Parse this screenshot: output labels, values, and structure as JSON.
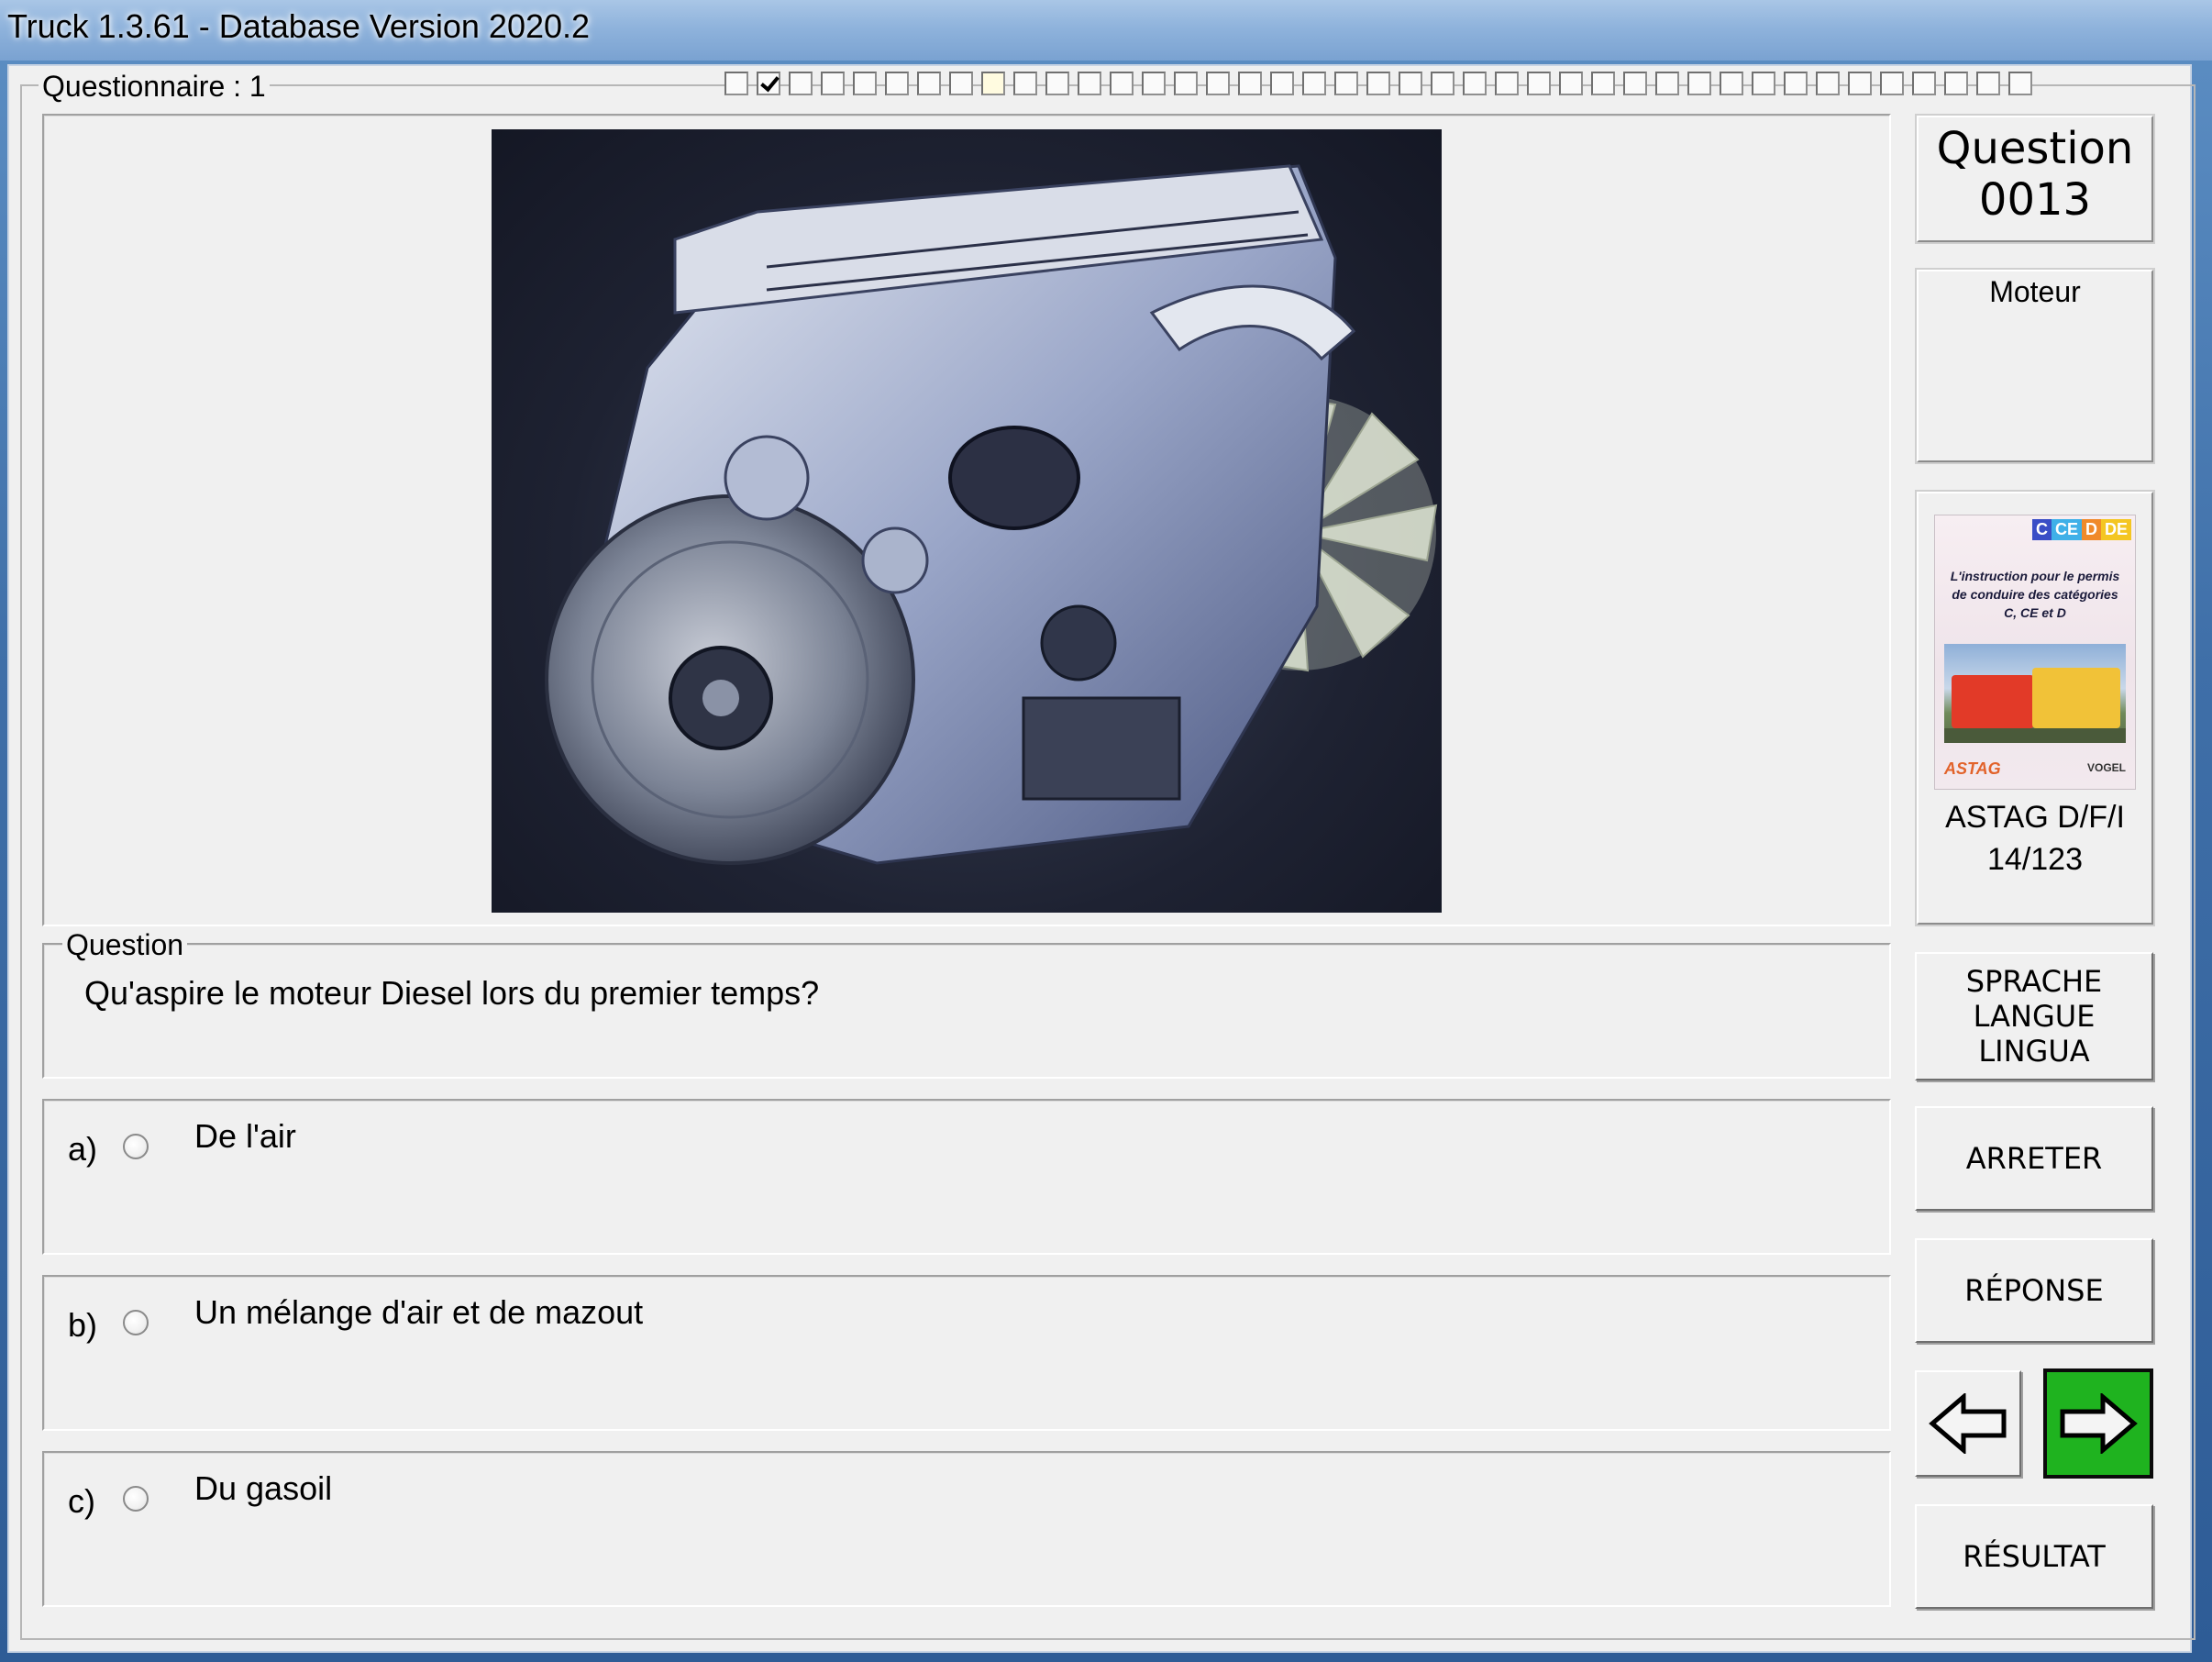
{
  "window": {
    "title": "Truck 1.3.61 - Database Version 2020.2"
  },
  "questionnaire": {
    "label": "Questionnaire : 1",
    "progress": [
      "empty",
      "checked",
      "empty",
      "empty",
      "empty",
      "empty",
      "empty",
      "empty",
      "current",
      "empty",
      "empty",
      "empty",
      "empty",
      "empty",
      "empty",
      "empty",
      "empty",
      "empty",
      "empty",
      "empty",
      "empty",
      "empty",
      "empty",
      "empty",
      "empty",
      "empty",
      "empty",
      "empty",
      "empty",
      "empty",
      "empty",
      "empty",
      "empty",
      "empty",
      "empty",
      "empty",
      "empty",
      "empty",
      "empty",
      "empty",
      "empty"
    ]
  },
  "question_box": {
    "line1": "Question",
    "number": "0013"
  },
  "category": {
    "label": "Moteur"
  },
  "book": {
    "badges": [
      "C",
      "CE",
      "D",
      "DE"
    ],
    "cover_text": "L'instruction pour le permis de conduire des catégories C, CE et D",
    "source": "ASTAG D/F/I",
    "page": "14/123",
    "publisher_left": "ASTAG",
    "publisher_right": "VOGEL"
  },
  "question": {
    "group_label": "Question",
    "text": "Qu'aspire le moteur Diesel lors du premier temps?"
  },
  "answers": [
    {
      "letter": "a)",
      "text": "De l'air"
    },
    {
      "letter": "b)",
      "text": "Un mélange d'air et de mazout"
    },
    {
      "letter": "c)",
      "text": "Du gasoil"
    }
  ],
  "buttons": {
    "language_l1": "SPRACHE",
    "language_l2": "LANGUE",
    "language_l3": "LINGUA",
    "stop": "ARRETER",
    "answer": "RÉPONSE",
    "result": "RÉSULTAT"
  },
  "icons": {
    "prev": "arrow-left-icon",
    "next": "arrow-right-icon"
  },
  "colors": {
    "next_button_bg": "#1fb31f",
    "title_bar": "#8fb3dc",
    "client_bg": "#f0f0f0"
  }
}
